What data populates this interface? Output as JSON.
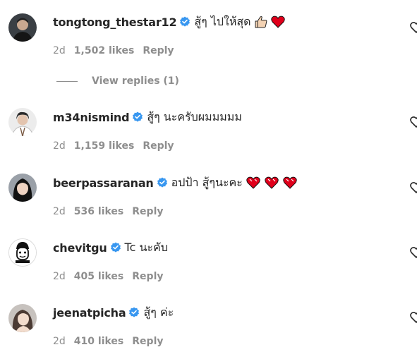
{
  "colors": {
    "verified": "#3897f0",
    "heart": "#e0001b",
    "muted": "#8e8e8e",
    "text": "#262626"
  },
  "comments": [
    {
      "username": "tongtong_thestar12",
      "text": "สู้ๆ ไปให้สุด",
      "emojis": [
        "thumbs-up-icon",
        "red-heart-icon"
      ],
      "time": "2d",
      "likes": "1,502 likes",
      "reply": "Reply",
      "view_replies": "View replies (1)"
    },
    {
      "username": "m34nismind",
      "text": "สู้ๆ นะครับผมมมมม",
      "emojis": [],
      "time": "2d",
      "likes": "1,159 likes",
      "reply": "Reply"
    },
    {
      "username": "beerpassaranan",
      "text": "อปป้า สู้ๆนะคะ",
      "emojis": [
        "heart-icon",
        "heart-icon",
        "heart-icon"
      ],
      "time": "2d",
      "likes": "536 likes",
      "reply": "Reply"
    },
    {
      "username": "chevitgu",
      "text": "Tc นะคับ",
      "emojis": [],
      "time": "2d",
      "likes": "405 likes",
      "reply": "Reply"
    },
    {
      "username": "jeenatpicha",
      "text": "สู้ๆ ค่ะ",
      "emojis": [],
      "time": "2d",
      "likes": "410 likes",
      "reply": "Reply"
    }
  ]
}
